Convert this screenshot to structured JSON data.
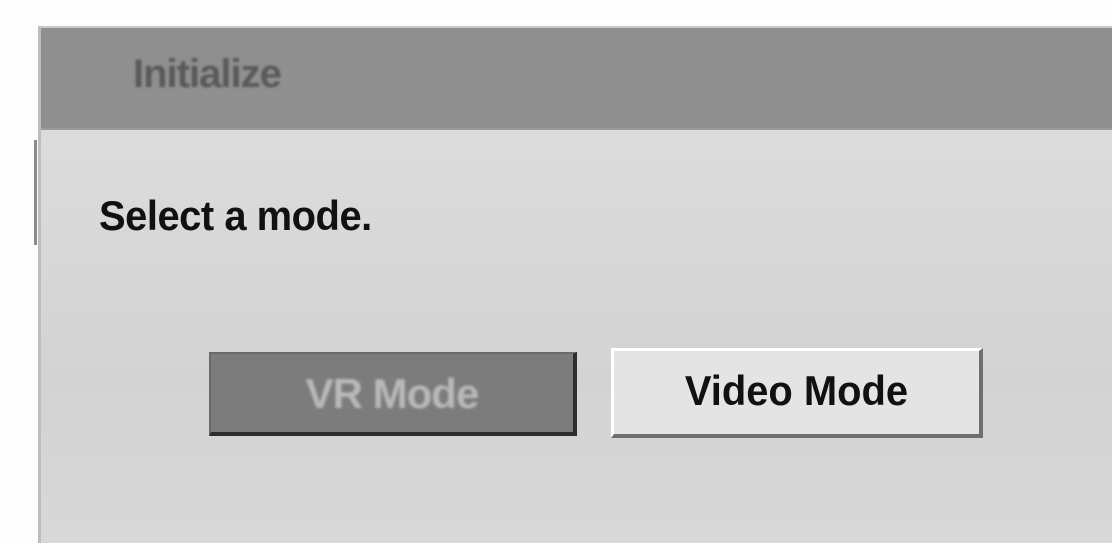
{
  "dialog": {
    "title": "Initialize",
    "prompt": "Select a mode.",
    "buttons": {
      "vr_mode_label": "VR Mode",
      "video_mode_label": "Video Mode"
    },
    "selected": "vr_mode"
  }
}
